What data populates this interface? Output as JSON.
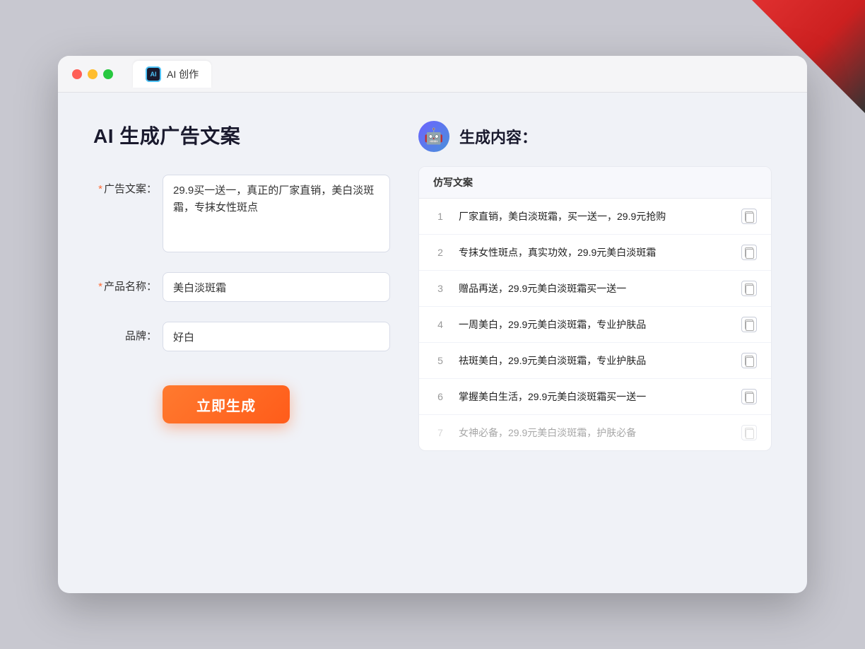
{
  "window": {
    "tab_label": "AI 创作"
  },
  "page": {
    "title": "AI 生成广告文案"
  },
  "form": {
    "ad_copy_label": "广告文案：",
    "ad_copy_required": "*",
    "ad_copy_value": "29.9买一送一，真正的厂家直销，美白淡斑霜，专抹女性斑点",
    "product_name_label": "产品名称：",
    "product_name_required": "*",
    "product_name_value": "美白淡斑霜",
    "brand_label": "品牌：",
    "brand_value": "好白",
    "generate_button_label": "立即生成"
  },
  "result": {
    "header": "生成内容：",
    "column_label": "仿写文案",
    "rows": [
      {
        "number": "1",
        "text": "厂家直销，美白淡斑霜，买一送一，29.9元抢购",
        "dimmed": false
      },
      {
        "number": "2",
        "text": "专抹女性斑点，真实功效，29.9元美白淡斑霜",
        "dimmed": false
      },
      {
        "number": "3",
        "text": "赠品再送，29.9元美白淡斑霜买一送一",
        "dimmed": false
      },
      {
        "number": "4",
        "text": "一周美白，29.9元美白淡斑霜，专业护肤品",
        "dimmed": false
      },
      {
        "number": "5",
        "text": "祛斑美白，29.9元美白淡斑霜，专业护肤品",
        "dimmed": false
      },
      {
        "number": "6",
        "text": "掌握美白生活，29.9元美白淡斑霜买一送一",
        "dimmed": false
      },
      {
        "number": "7",
        "text": "女神必备，29.9元美白淡斑霜，护肤必备",
        "dimmed": true
      }
    ]
  }
}
